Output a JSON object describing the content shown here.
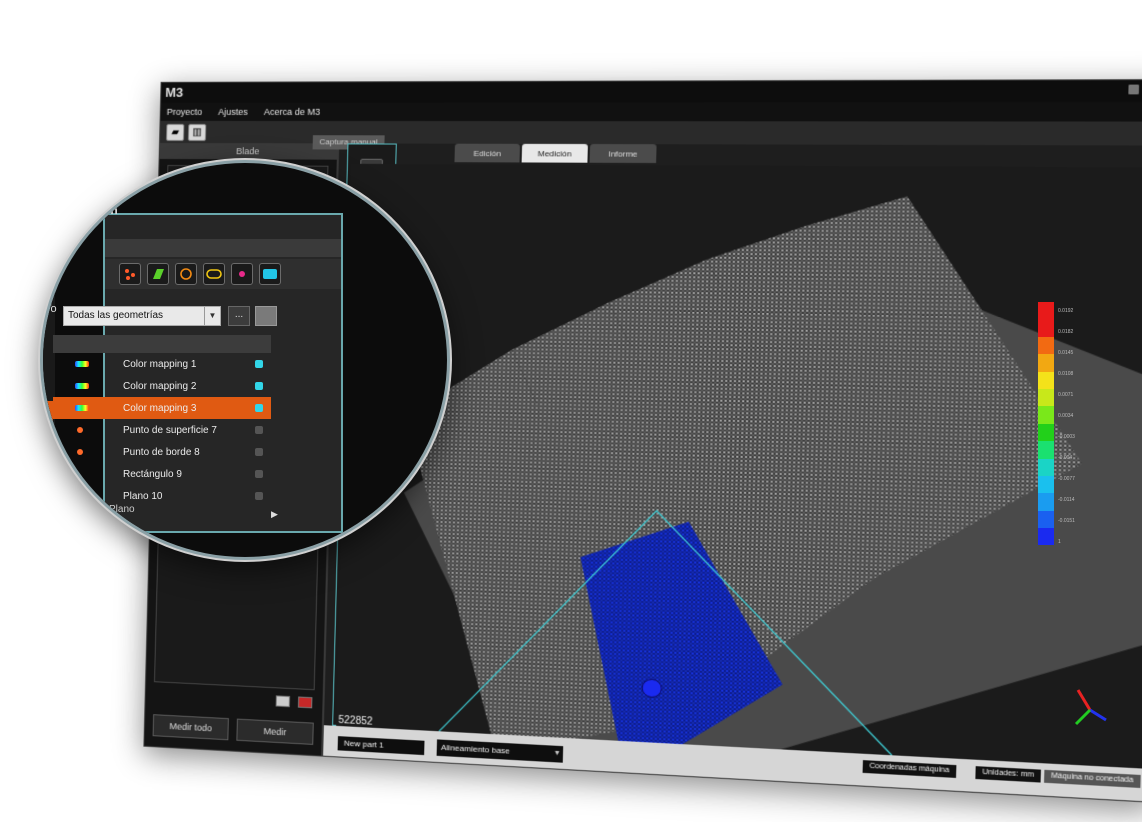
{
  "window": {
    "app_logo": "M3",
    "menu": [
      "Proyecto",
      "Ajustes",
      "Acerca de M3"
    ]
  },
  "left_panel": {
    "header": "Blade",
    "measure_all_label": "Medir todo",
    "measure_label": "Medir"
  },
  "capture_tab_label": "Captura manual",
  "view_tabs": [
    {
      "label": "Edición",
      "active": false
    },
    {
      "label": "Medición",
      "active": true
    },
    {
      "label": "Informe",
      "active": false
    }
  ],
  "viewport": {
    "point_count": "522852"
  },
  "color_scale": {
    "colors": [
      "#e81a1a",
      "#e81a1a",
      "#f26a12",
      "#f2a812",
      "#f4e21a",
      "#c8e81a",
      "#7ae81a",
      "#22d01a",
      "#1ae070",
      "#1ad4c6",
      "#1ac0ee",
      "#1a9cf0",
      "#1a60f0",
      "#1a2af0"
    ],
    "labels": [
      "0.0192",
      "0.0182",
      "0.0145",
      "0.0108",
      "0.0071",
      "0.0034",
      "-0.0003",
      "-0.004",
      "-0.0077",
      "-0.0114",
      "-0.0151",
      "1"
    ]
  },
  "status_bar": {
    "part_name": "New part 1",
    "alignment": "Alineamiento base",
    "machine_coords": "Coordenadas máquina",
    "units": "Unidades: mm",
    "machine_status": "Máquina no conectada"
  },
  "magnifier": {
    "panel_title": "ón",
    "panel_title2": "ón",
    "left_text": "To",
    "geometry_filter": "Todas las geometrías",
    "filter_btn_1": "...",
    "list": [
      {
        "label": "Color mapping 1",
        "icon": "rainbow",
        "checked": true,
        "selected": false
      },
      {
        "label": "Color mapping 2",
        "icon": "rainbow",
        "checked": true,
        "selected": false
      },
      {
        "label": "Color mapping 3",
        "icon": "rainbow",
        "checked": true,
        "selected": true
      },
      {
        "label": "Punto de superficie 7",
        "icon": "dot",
        "checked": false,
        "selected": false
      },
      {
        "label": "Punto de borde 8",
        "icon": "dot",
        "checked": false,
        "selected": false
      },
      {
        "label": "Rectángulo 9",
        "icon": "none",
        "checked": false,
        "selected": false
      },
      {
        "label": "Plano 10",
        "icon": "none",
        "checked": false,
        "selected": false
      }
    ],
    "plano_overflow": "Plano",
    "accent": "#e05a12",
    "check_on": "#32d6e8"
  }
}
